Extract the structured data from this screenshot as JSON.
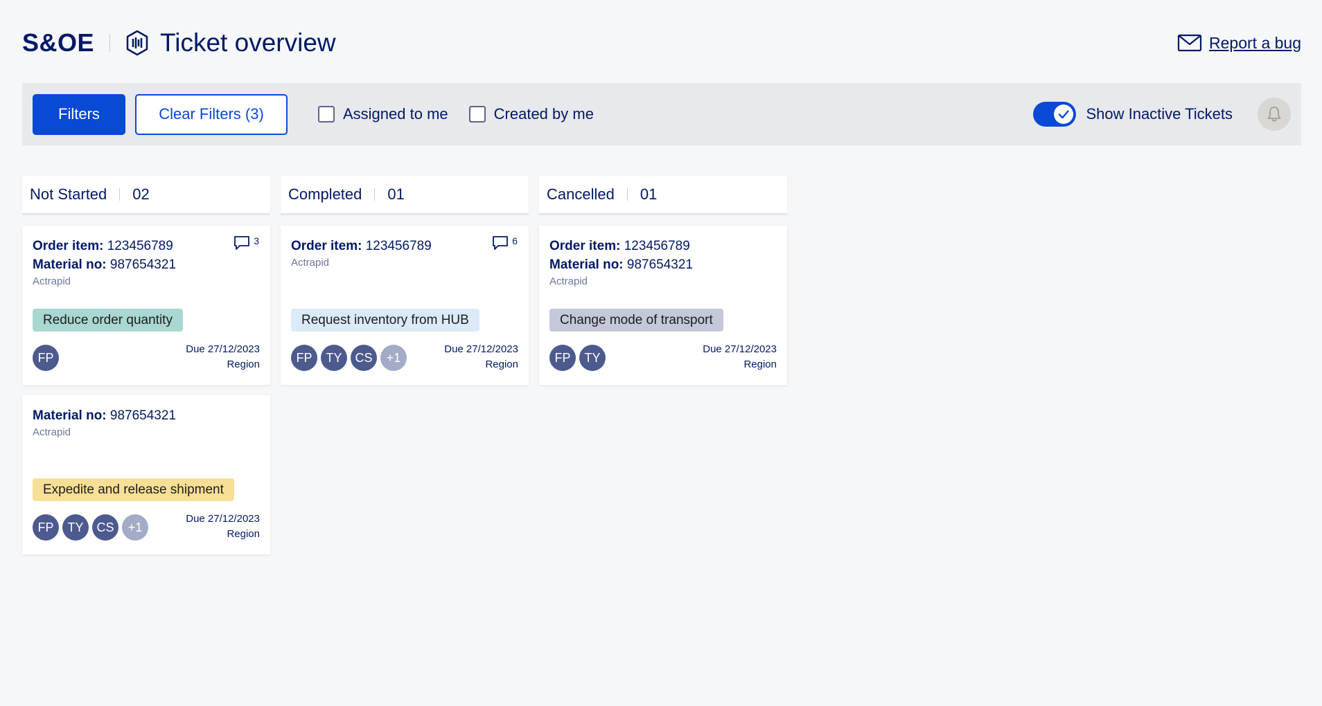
{
  "header": {
    "brand": "S&OE",
    "page_title": "Ticket overview",
    "report_bug": "Report a bug"
  },
  "toolbar": {
    "filters_label": "Filters",
    "clear_filters_label": "Clear Filters (3)",
    "assigned_to_me": "Assigned to me",
    "created_by_me": "Created by me",
    "show_inactive": "Show Inactive Tickets",
    "show_inactive_on": true
  },
  "colors": {
    "primary": "#0849d6",
    "navy": "#001965",
    "tag_reduce": "#a9d7d1",
    "tag_request": "#dbeaf8",
    "tag_change": "#c5c8d9",
    "tag_expedite": "#f7df97"
  },
  "columns": [
    {
      "title": "Not Started",
      "count": "02",
      "cards": [
        {
          "order_label": "Order item:",
          "order_value": "123456789",
          "material_label": "Material no:",
          "material_value": "987654321",
          "product": "Actrapid",
          "comments": "3",
          "tag": "Reduce order quantity",
          "avatars": [
            "FP"
          ],
          "more": "",
          "due": "Due 27/12/2023",
          "region": "Region"
        },
        {
          "order_label": "",
          "order_value": "",
          "material_label": "Material no:",
          "material_value": "987654321",
          "product": "Actrapid",
          "comments": "",
          "tag": "Expedite and release shipment",
          "avatars": [
            "FP",
            "TY",
            "CS"
          ],
          "more": "+1",
          "due": "Due 27/12/2023",
          "region": "Region"
        }
      ]
    },
    {
      "title": "Completed",
      "count": "01",
      "cards": [
        {
          "order_label": "Order item:",
          "order_value": "123456789",
          "material_label": "",
          "material_value": "",
          "product": "Actrapid",
          "comments": "6",
          "tag": "Request inventory from HUB",
          "avatars": [
            "FP",
            "TY",
            "CS"
          ],
          "more": "+1",
          "due": "Due 27/12/2023",
          "region": "Region"
        }
      ]
    },
    {
      "title": "Cancelled",
      "count": "01",
      "cards": [
        {
          "order_label": "Order item:",
          "order_value": "123456789",
          "material_label": "Material no:",
          "material_value": "987654321",
          "product": "Actrapid",
          "comments": "",
          "tag": "Change mode of transport",
          "avatars": [
            "FP",
            "TY"
          ],
          "more": "",
          "due": "Due 27/12/2023",
          "region": "Region"
        }
      ]
    }
  ]
}
